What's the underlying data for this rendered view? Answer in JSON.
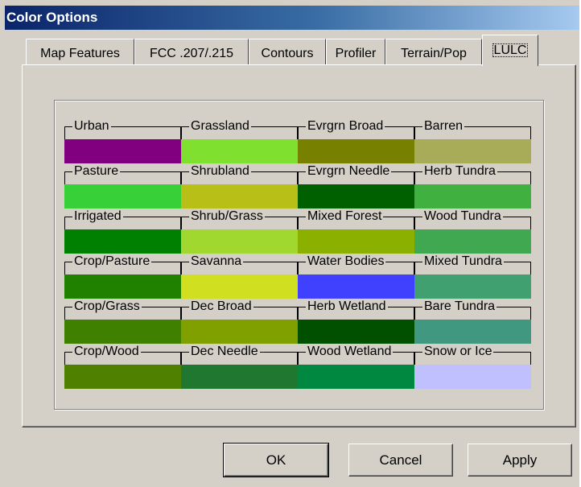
{
  "window": {
    "title": "Color Options"
  },
  "tabs": [
    {
      "label": "Map Features",
      "active": false
    },
    {
      "label": "FCC .207/.215",
      "active": false
    },
    {
      "label": "Contours",
      "active": false
    },
    {
      "label": "Profiler",
      "active": false
    },
    {
      "label": "Terrain/Pop",
      "active": false
    },
    {
      "label": "LULC",
      "active": true
    }
  ],
  "lulc": {
    "rows": [
      [
        {
          "label": "Urban",
          "color": "#800080"
        },
        {
          "label": "Grassland",
          "color": "#80e030"
        },
        {
          "label": "Evrgrn Broad",
          "color": "#788000"
        },
        {
          "label": "Barren",
          "color": "#a8ac58"
        }
      ],
      [
        {
          "label": "Pasture",
          "color": "#38d038"
        },
        {
          "label": "Shrubland",
          "color": "#b8c018"
        },
        {
          "label": "Evrgrn Needle",
          "color": "#006000"
        },
        {
          "label": "Herb Tundra",
          "color": "#40b040"
        }
      ],
      [
        {
          "label": "Irrigated",
          "color": "#008000"
        },
        {
          "label": "Shrub/Grass",
          "color": "#a0d830"
        },
        {
          "label": "Mixed Forest",
          "color": "#8cb000"
        },
        {
          "label": "Wood Tundra",
          "color": "#40a850"
        }
      ],
      [
        {
          "label": "Crop/Pasture",
          "color": "#208000"
        },
        {
          "label": "Savanna",
          "color": "#d0e020"
        },
        {
          "label": "Water Bodies",
          "color": "#4040ff"
        },
        {
          "label": "Mixed Tundra",
          "color": "#40a070"
        }
      ],
      [
        {
          "label": "Crop/Grass",
          "color": "#408000"
        },
        {
          "label": "Dec Broad",
          "color": "#80a000"
        },
        {
          "label": "Herb Wetland",
          "color": "#005000"
        },
        {
          "label": "Bare Tundra",
          "color": "#409880"
        }
      ],
      [
        {
          "label": "Crop/Wood",
          "color": "#508000"
        },
        {
          "label": "Dec Needle",
          "color": "#207830"
        },
        {
          "label": "Wood Wetland",
          "color": "#008840"
        },
        {
          "label": "Snow or Ice",
          "color": "#c0c0ff"
        }
      ]
    ]
  },
  "buttons": {
    "ok": "OK",
    "cancel": "Cancel",
    "apply": "Apply"
  }
}
